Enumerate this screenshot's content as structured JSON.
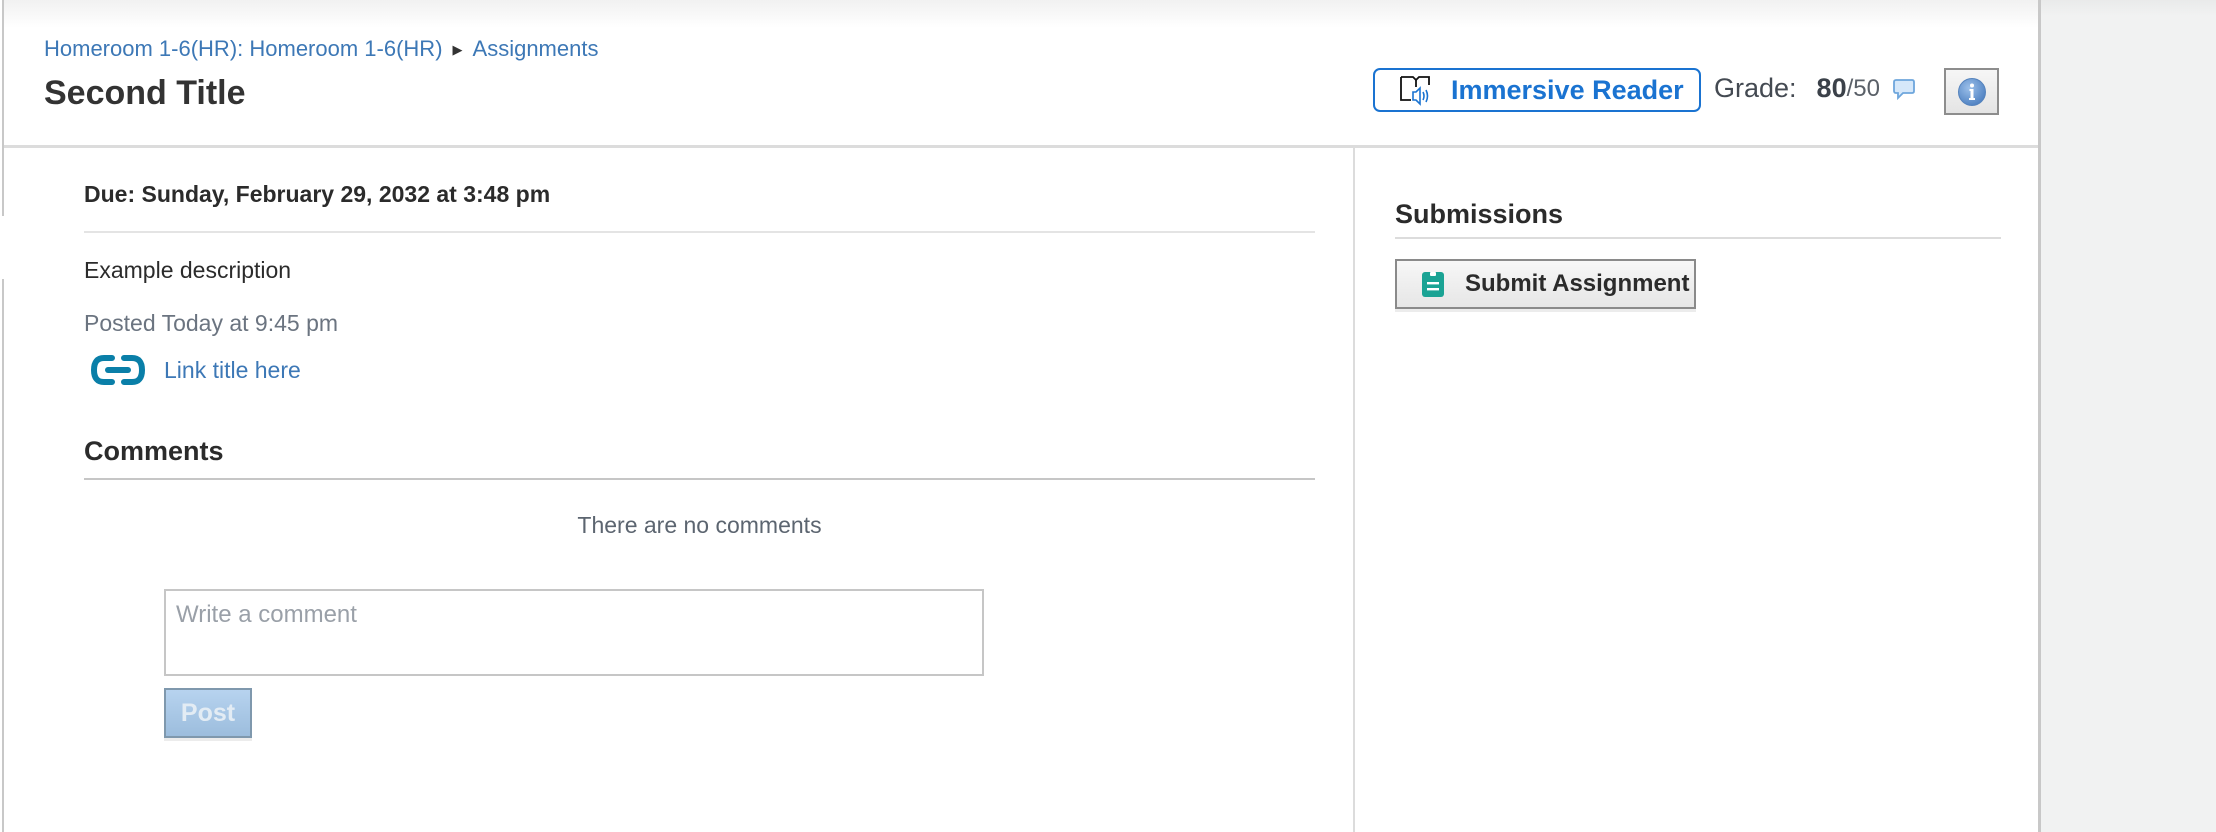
{
  "header": {
    "breadcrumb": [
      {
        "label": "Homeroom 1-6(HR): Homeroom 1-6(HR)"
      },
      {
        "label": "Assignments"
      }
    ],
    "breadcrumb_separator": "▶",
    "title": "Second Title",
    "immersive_reader_label": "Immersive Reader",
    "grade_label": "Grade:",
    "grade_score": "80",
    "grade_max": "/50"
  },
  "assignment": {
    "due": "Due: Sunday, February 29, 2032 at 3:48 pm",
    "description": "Example description",
    "posted": "Posted Today at 9:45 pm",
    "link_title": "Link title here"
  },
  "comments": {
    "heading": "Comments",
    "empty_message": "There are no comments",
    "input_value": "",
    "input_placeholder": "Write a comment",
    "post_label": "Post"
  },
  "submissions": {
    "heading": "Submissions",
    "submit_label": "Submit Assignment"
  },
  "colors": {
    "link": "#3d78b6",
    "immersive_accent": "#1a73d1",
    "link_icon": "#0a7fa8",
    "submit_icon": "#1aa394"
  }
}
